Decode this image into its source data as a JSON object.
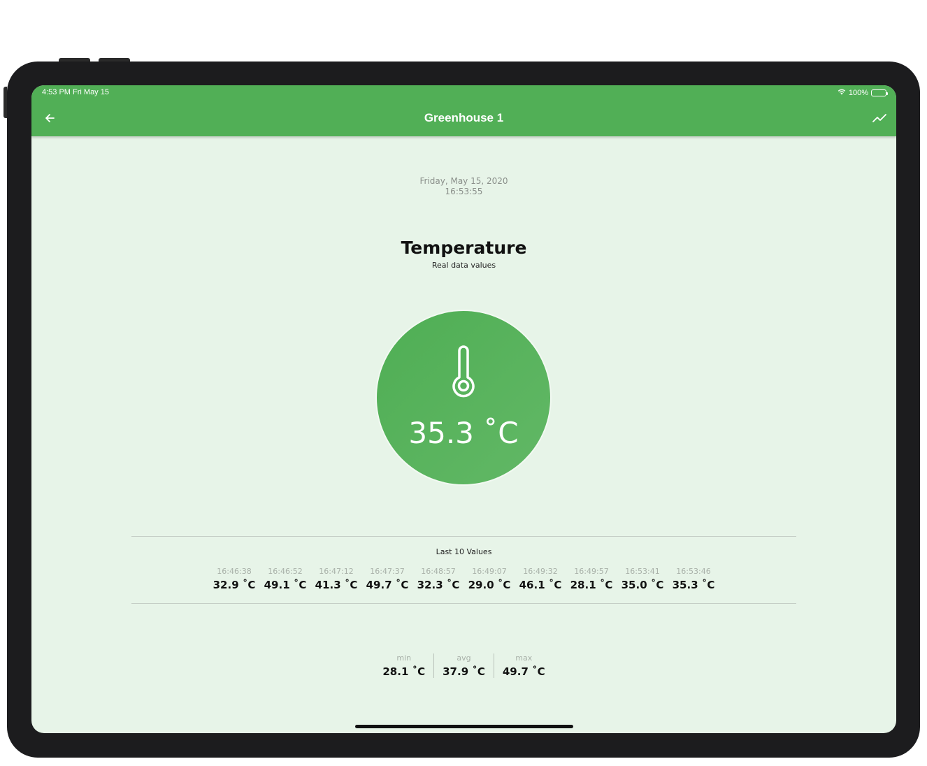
{
  "status_bar": {
    "time": "4:53 PM   Fri May 15",
    "battery": "100%"
  },
  "app_bar": {
    "title": "Greenhouse 1",
    "back_icon": "arrow-left-icon",
    "chart_icon": "trending-up-icon"
  },
  "reading": {
    "date": "Friday, May 15, 2020",
    "time": "16:53:55",
    "title": "Temperature",
    "subtitle": "Real data values",
    "current": "35.3 ˚C",
    "icon": "thermometer-icon"
  },
  "history": {
    "title": "Last 10 Values",
    "items": [
      {
        "time": "16:46:38",
        "value": "32.9 ˚C"
      },
      {
        "time": "16:46:52",
        "value": "49.1 ˚C"
      },
      {
        "time": "16:47:12",
        "value": "41.3 ˚C"
      },
      {
        "time": "16:47:37",
        "value": "49.7 ˚C"
      },
      {
        "time": "16:48:57",
        "value": "32.3 ˚C"
      },
      {
        "time": "16:49:07",
        "value": "29.0 ˚C"
      },
      {
        "time": "16:49:32",
        "value": "46.1 ˚C"
      },
      {
        "time": "16:49:57",
        "value": "28.1 ˚C"
      },
      {
        "time": "16:53:41",
        "value": "35.0 ˚C"
      },
      {
        "time": "16:53:46",
        "value": "35.3 ˚C"
      }
    ]
  },
  "stats": {
    "min_label": "min",
    "min_value": "28.1 ˚C",
    "avg_label": "avg",
    "avg_value": "37.9 ˚C",
    "max_label": "max",
    "max_value": "49.7 ˚C"
  },
  "colors": {
    "primary": "#51af56",
    "background": "#e7f4e8"
  }
}
